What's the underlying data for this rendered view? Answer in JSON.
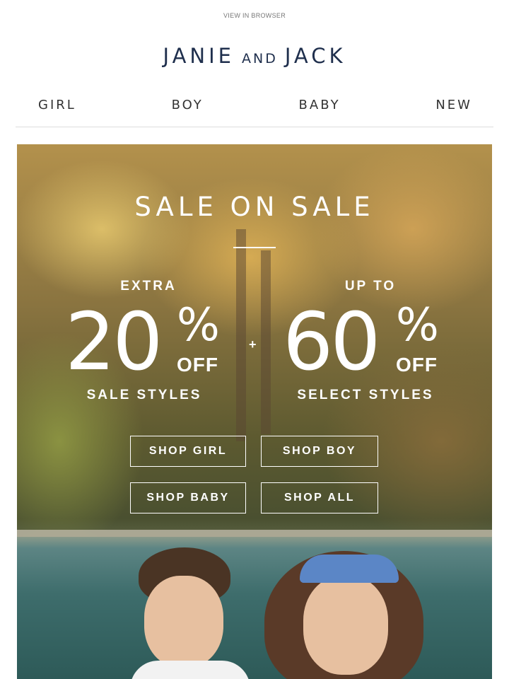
{
  "header": {
    "view_in_browser": "VIEW IN BROWSER",
    "logo_janie": "JANIE",
    "logo_and": "AND",
    "logo_jack": "JACK",
    "brand_color": "#1f2f4d"
  },
  "nav": {
    "items": [
      "GIRL",
      "BOY",
      "BABY",
      "NEW"
    ]
  },
  "hero": {
    "title": "SALE ON SALE",
    "left_offer": {
      "prefix": "EXTRA",
      "number": "20",
      "percent": "%",
      "off": "OFF",
      "suffix": "SALE STYLES"
    },
    "plus": "+",
    "right_offer": {
      "prefix": "UP TO",
      "number": "60",
      "percent": "%",
      "off": "OFF",
      "suffix": "SELECT STYLES"
    },
    "buttons": [
      "SHOP GIRL",
      "SHOP BOY",
      "SHOP BABY",
      "SHOP ALL"
    ]
  }
}
